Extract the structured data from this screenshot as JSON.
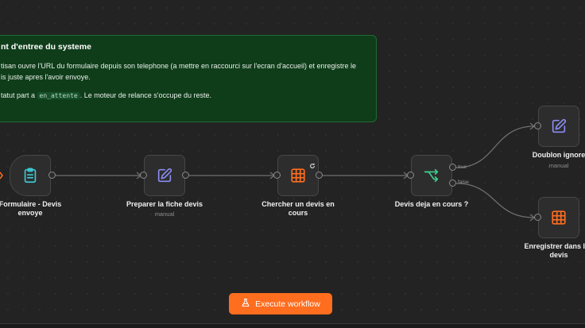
{
  "sticky_note": {
    "title": "nt d'entree du systeme",
    "line1": "tisan ouvre l'URL du formulaire depuis son telephone (a mettre en raccourci sur l'ecran d'accueil) et enregistre le",
    "line2": "is juste apres l'avoir envoye.",
    "line3_before": "tatut part a ",
    "line3_code": "en_attente",
    "line3_after": ". Le moteur de relance s'occupe du reste."
  },
  "nodes": {
    "form_trigger": {
      "label_line1": "Formulaire - Devis",
      "label_line2": "envoye",
      "icon": "clipboard-icon"
    },
    "prepare": {
      "label": "Preparer la fiche devis",
      "sub": "manual",
      "icon": "pencil-edit-icon"
    },
    "search": {
      "label_line1": "Chercher un devis en",
      "label_line2": "cours",
      "icon": "table-grid-icon"
    },
    "condition": {
      "label": "Devis deja en cours ?",
      "icon": "branch-icon",
      "true_label": "true",
      "false_label": "false"
    },
    "duplicate": {
      "label": "Doublon ignore",
      "sub": "manual",
      "icon": "pencil-edit-icon"
    },
    "save": {
      "label_line1": "Enregistrer dans la t",
      "label_line2": "devis",
      "icon": "table-grid-icon"
    }
  },
  "toolbar": {
    "execute_label": "Execute workflow",
    "execute_icon": "flask-icon"
  },
  "colors": {
    "accent": "#ff6d1f",
    "sticky_bg": "#0f3d1a",
    "table_icon": "#ff6d1f",
    "edit_icon": "#8b8cf0",
    "branch_icon": "#3ecf8e",
    "clipboard_icon": "#3ec7d4"
  }
}
